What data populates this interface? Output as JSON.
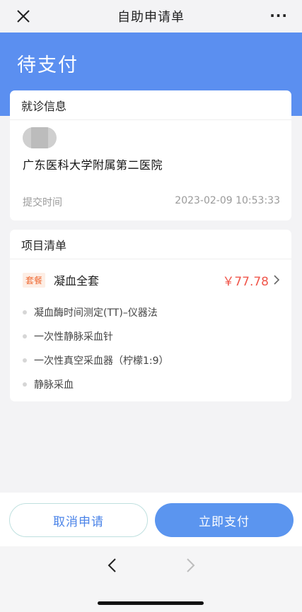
{
  "nav": {
    "title": "自助申请单",
    "more": "···"
  },
  "header": {
    "status": "待支付"
  },
  "visit": {
    "section_title": "就诊信息",
    "hospital": "广东医科大学附属第二医院",
    "submit_label": "提交时间",
    "submit_time": "2023-02-09 10:53:33"
  },
  "items": {
    "section_title": "项目清单",
    "package": {
      "badge": "套餐",
      "name": "凝血全套",
      "price": "￥77.78"
    },
    "sub_items": [
      "凝血酶时间测定(TT)–仪器法",
      "一次性静脉采血针",
      "一次性真空采血器（柠檬1:9）",
      "静脉采血"
    ]
  },
  "actions": {
    "cancel_label": "取消申请",
    "pay_label": "立即支付"
  },
  "colors": {
    "primary": "#5b8ff0",
    "price": "#f0564b",
    "badge": "#ef6a34"
  }
}
